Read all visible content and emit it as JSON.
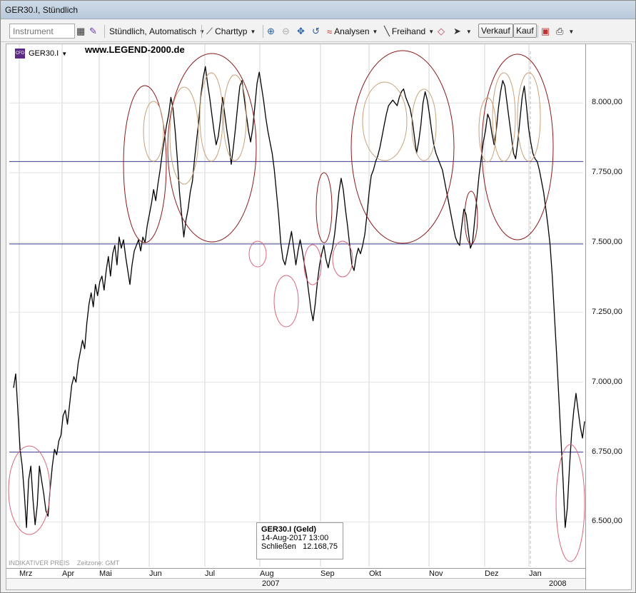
{
  "window": {
    "title": "GER30.I, Stündlich"
  },
  "toolbar": {
    "instrument_placeholder": "Instrument",
    "interval_label": "Stündlich,",
    "mode_label": "Automatisch",
    "charttype_label": "Charttyp",
    "analysen_label": "Analysen",
    "freihand_label": "Freihand",
    "verkauf_label": "Verkauf",
    "kauf_label": "Kauf"
  },
  "chart_header": {
    "symbol": "GER30.I",
    "badge": "CFD",
    "watermark": "www.LEGEND-2000.de"
  },
  "tooltip": {
    "title": "GER30.I (Geld)",
    "datetime": "14-Aug-2017 13:00",
    "close_label": "Schließen",
    "close_value": "12.168,75"
  },
  "footer": {
    "indicative": "INDIKATIVER PREIS",
    "timezone": "Zeitzone: GMT"
  },
  "colors": {
    "price_line": "#000000",
    "hline": "#3c3c8c",
    "circle_big": "#8b1a1a",
    "circle_small": "#c9a27a",
    "circle_pink": "#d9667a"
  },
  "chart_data": {
    "type": "line",
    "title": "",
    "xlabel": "",
    "ylabel": "",
    "ylim": [
      6300,
      8200
    ],
    "y_ticks": [
      "8.000,00",
      "7.750,00",
      "7.500,00",
      "7.250,00",
      "7.000,00",
      "6.750,00",
      "6.500,00"
    ],
    "y_tick_values": [
      8000,
      7750,
      7500,
      7250,
      7000,
      6750,
      6500
    ],
    "months": [
      "Mrz",
      "Apr",
      "Mai",
      "Jun",
      "Jul",
      "Aug",
      "Sep",
      "Okt",
      "Nov",
      "Dez",
      "Jan"
    ],
    "years": [
      "2007",
      "2008"
    ],
    "horizontal_lines": [
      7790,
      7495,
      6750
    ],
    "series": [
      {
        "values": [
          6980,
          7030,
          6900,
          6760,
          6700,
          6600,
          6480,
          6650,
          6700,
          6580,
          6490,
          6560,
          6700,
          6650,
          6600,
          6540,
          6520,
          6620,
          6700,
          6760,
          6740,
          6790,
          6810,
          6880,
          6900,
          6850,
          6920,
          6990,
          7020,
          7000,
          7070,
          7110,
          7150,
          7120,
          7210,
          7280,
          7320,
          7270,
          7350,
          7310,
          7360,
          7380,
          7330,
          7400,
          7450,
          7380,
          7460,
          7490,
          7420,
          7520,
          7480,
          7510,
          7450,
          7400,
          7350,
          7420,
          7470,
          7490,
          7510,
          7470,
          7520,
          7500,
          7560,
          7600,
          7640,
          7690,
          7650,
          7710,
          7760,
          7820,
          7870,
          7920,
          7960,
          8020,
          7980,
          7900,
          7800,
          7680,
          7600,
          7520,
          7580,
          7620,
          7680,
          7720,
          7800,
          7870,
          7940,
          8030,
          8090,
          8130,
          8070,
          8020,
          7960,
          7900,
          7850,
          7880,
          7940,
          8020,
          7960,
          7900,
          7850,
          7780,
          7840,
          7910,
          7990,
          8060,
          8080,
          8020,
          7960,
          7900,
          7860,
          7910,
          7990,
          8070,
          8110,
          8060,
          8010,
          7950,
          7900,
          7860,
          7820,
          7760,
          7680,
          7600,
          7500,
          7440,
          7420,
          7460,
          7500,
          7540,
          7480,
          7420,
          7470,
          7510,
          7470,
          7420,
          7380,
          7320,
          7260,
          7220,
          7280,
          7360,
          7420,
          7460,
          7490,
          7440,
          7410,
          7450,
          7480,
          7530,
          7600,
          7680,
          7730,
          7690,
          7620,
          7560,
          7490,
          7420,
          7400,
          7450,
          7480,
          7460,
          7490,
          7530,
          7600,
          7680,
          7740,
          7760,
          7790,
          7810,
          7840,
          7880,
          7920,
          7960,
          7990,
          8000,
          8010,
          8000,
          7990,
          8020,
          8040,
          8050,
          8020,
          8000,
          7980,
          7940,
          7880,
          7820,
          7860,
          7920,
          8000,
          8040,
          8010,
          7960,
          7900,
          7850,
          7820,
          7800,
          7780,
          7760,
          7720,
          7680,
          7640,
          7600,
          7560,
          7520,
          7500,
          7490,
          7560,
          7620,
          7600,
          7540,
          7480,
          7500,
          7580,
          7660,
          7740,
          7800,
          7860,
          7900,
          7960,
          7940,
          7890,
          7850,
          7900,
          7980,
          8040,
          8080,
          8060,
          8000,
          7940,
          7880,
          7820,
          7800,
          7860,
          7940,
          8020,
          8060,
          7990,
          7910,
          7860,
          7820,
          7800,
          7790,
          7760,
          7720,
          7680,
          7620,
          7560,
          7490,
          7380,
          7240,
          7100,
          6950,
          6800,
          6650,
          6480,
          6550,
          6700,
          6820,
          6900,
          6960,
          6900,
          6840,
          6800,
          6860
        ]
      }
    ]
  }
}
